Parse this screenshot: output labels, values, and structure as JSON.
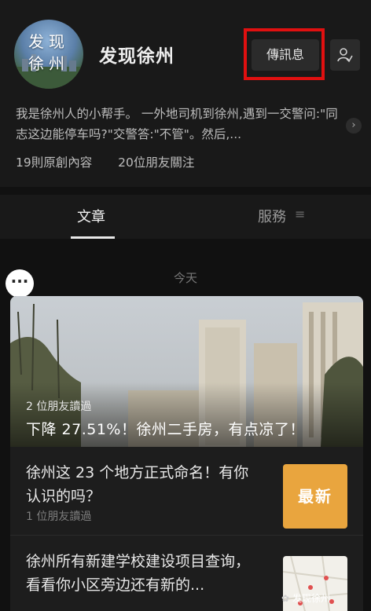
{
  "profile": {
    "avatar_text_line1": "发现",
    "avatar_text_line2": "徐州",
    "name": "发现徐州",
    "message_label": "傳訊息",
    "description": "我是徐州人的小帮手。 一外地司机到徐州,遇到一交警问:\"同志这边能停车吗?\"交警答:\"不管\"。然后,...",
    "stats_posts": "19則原創內容",
    "stats_friends": "20位朋友關注"
  },
  "tabs": {
    "articles": "文章",
    "services": "服務"
  },
  "feed": {
    "date_label": "今天",
    "featured": {
      "friends_read": "2 位朋友讀過",
      "title": "下降 27.51%！徐州二手房，有点凉了！"
    },
    "items": [
      {
        "title": "徐州这 23 个地方正式命名！有你认识的吗？",
        "friends_read": "1 位朋友讀過",
        "badge": "最新"
      },
      {
        "title": "徐州所有新建学校建设项目查询，看看你小区旁边还有新的..."
      }
    ]
  },
  "watermark": "发现徐州",
  "colors": {
    "background": "#111111",
    "header": "#191919",
    "highlight": "#e01010",
    "badge": "#e9a53e"
  },
  "icons": [
    "more-icon",
    "follow-icon",
    "chevron-right-icon",
    "menu-lines-icon",
    "wechat-icon"
  ]
}
